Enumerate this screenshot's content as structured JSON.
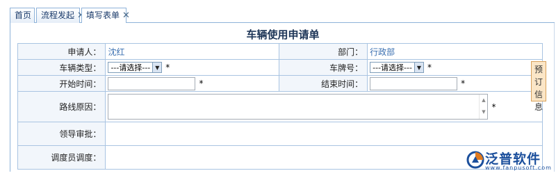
{
  "tabs": [
    {
      "label": "首页",
      "closable": false,
      "active": false
    },
    {
      "label": "流程发起",
      "closable": true,
      "active": false
    },
    {
      "label": "填写表单",
      "closable": true,
      "active": true
    }
  ],
  "close_glyph": "✕",
  "form": {
    "title": "车辆使用申请单",
    "applicant_label": "申请人：",
    "applicant_value": "沈红",
    "department_label": "部门：",
    "department_value": "行政部",
    "vehicle_type_label": "车辆类型：",
    "vehicle_type_value": "---请选择---",
    "plate_label": "车牌号：",
    "plate_value": "---请选择---",
    "start_time_label": "开始时间：",
    "start_time_value": "",
    "end_time_label": "结束时间：",
    "end_time_value": "",
    "route_label": "路线原因：",
    "route_value": "",
    "leader_label": "领导审批：",
    "dispatcher_label": "调度员调度：",
    "required_mark": "*"
  },
  "side_tab": {
    "line1": "预",
    "line2": "订",
    "line3": "信",
    "line4": "息"
  },
  "logo": {
    "name": "泛普软件",
    "url": "www.fanpusoft.com"
  },
  "colors": {
    "accent": "#1b4f9c",
    "border": "#a9c4e2",
    "value_text": "#3a6fb0"
  }
}
